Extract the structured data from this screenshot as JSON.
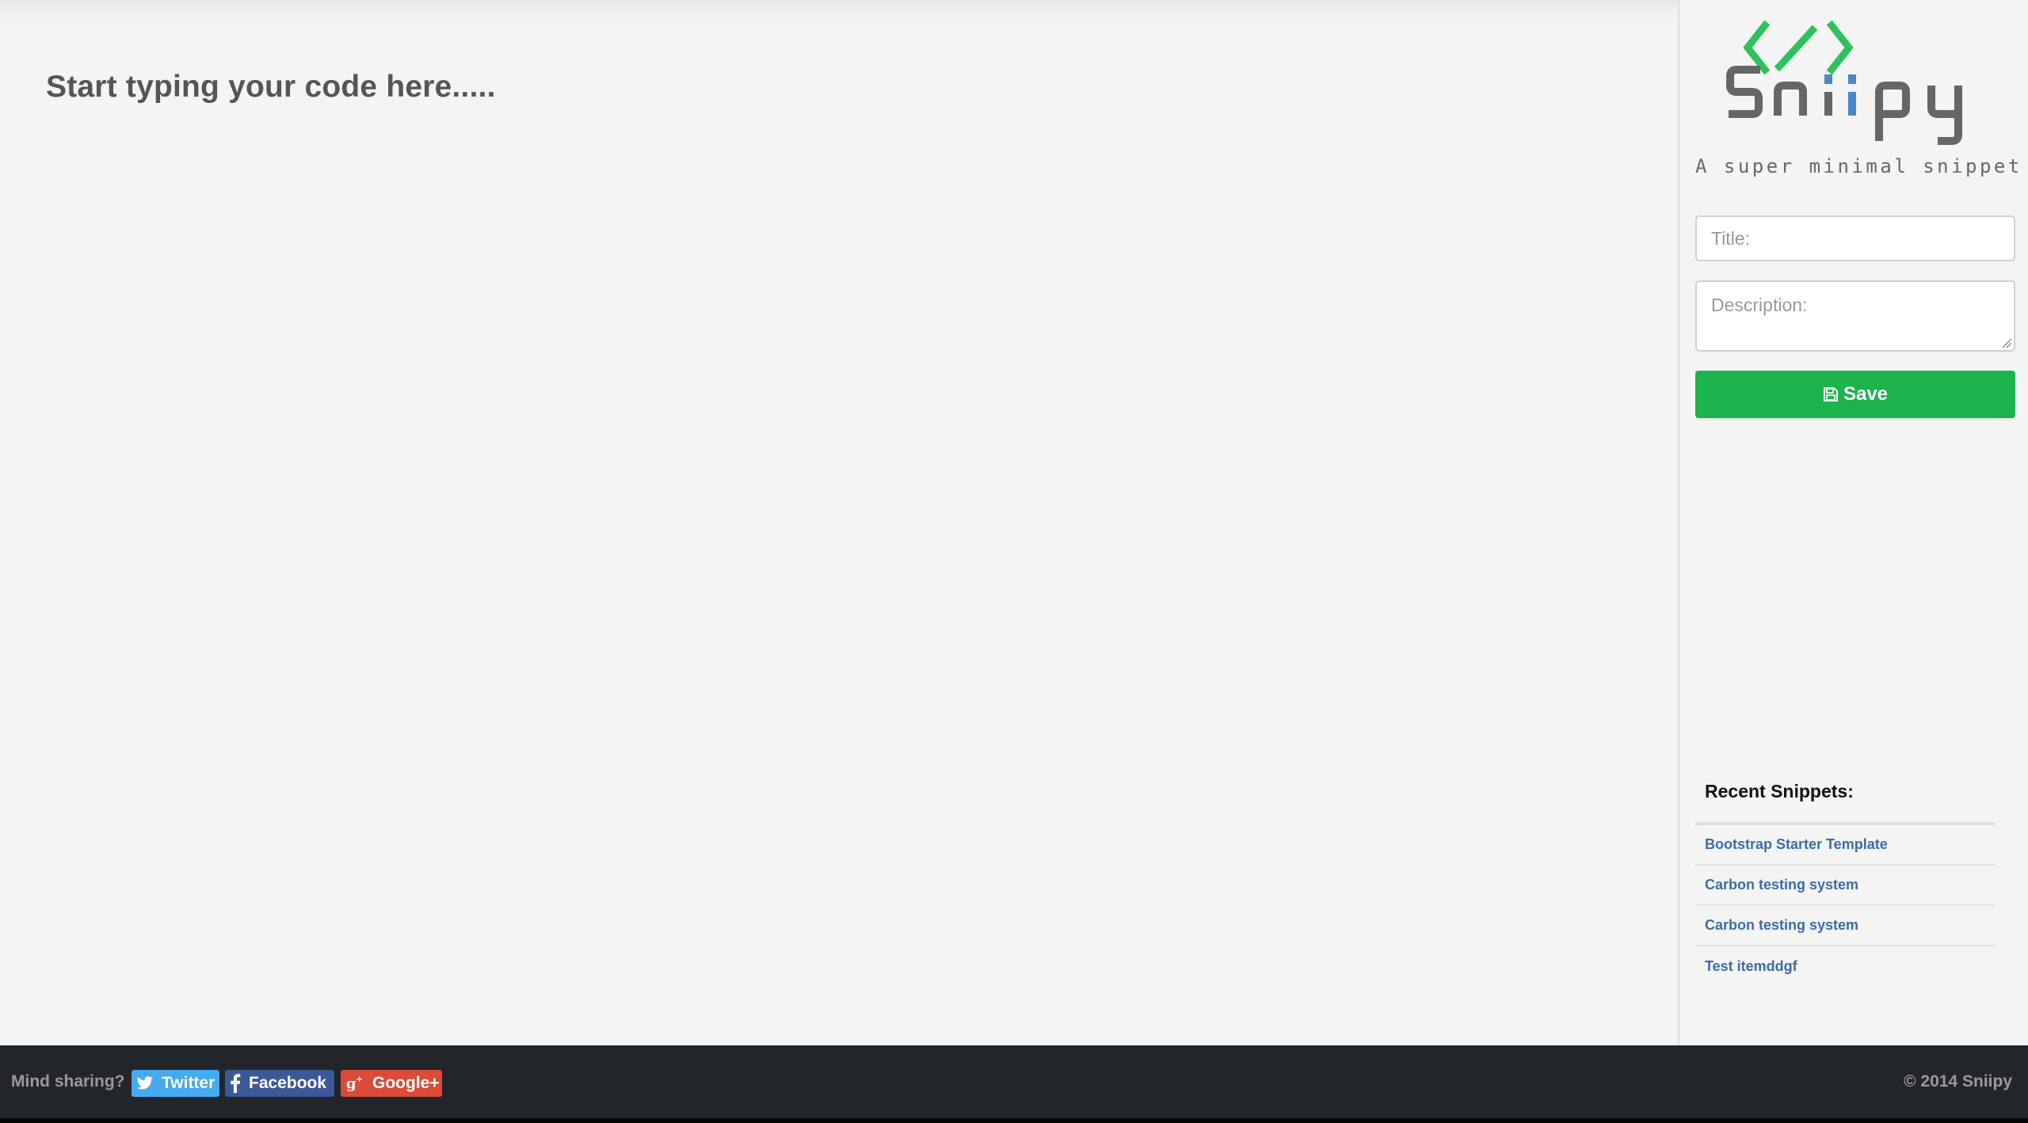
{
  "editor": {
    "placeholder": "Start typing your code here....."
  },
  "sidebar": {
    "logo": {
      "text": "Sniipy",
      "icon": "code-brackets-icon",
      "colors": {
        "icon": "#2ec15c",
        "text": "#666666",
        "accent_letters": "#4a86c8"
      }
    },
    "tagline": "A super minimal snippet tool",
    "form": {
      "title_placeholder": "Title:",
      "title_value": "",
      "description_placeholder": "Description:",
      "description_value": "",
      "save_label": "Save",
      "save_icon": "floppy-disk-icon",
      "save_color": "#1cb54c"
    },
    "recent": {
      "heading": "Recent Snippets:",
      "items": [
        {
          "label": "Bootstrap Starter Template"
        },
        {
          "label": "Carbon testing system"
        },
        {
          "label": "Carbon testing system"
        },
        {
          "label": "Test itemddgf"
        }
      ]
    }
  },
  "footer": {
    "share_prompt": "Mind sharing?",
    "share_buttons": [
      {
        "label": "Twitter",
        "icon": "twitter-bird-icon",
        "color": "#45aaf0"
      },
      {
        "label": "Facebook",
        "icon": "facebook-f-icon",
        "color": "#3b5897"
      },
      {
        "label": "Google+",
        "icon": "google-plus-icon",
        "color": "#dc4a38"
      }
    ],
    "copyright": "© 2014 Sniipy"
  }
}
